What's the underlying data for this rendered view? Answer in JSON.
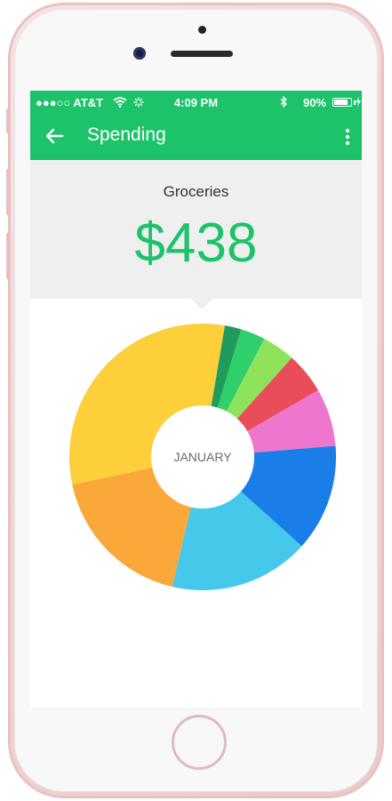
{
  "status_bar": {
    "carrier": "●●●○○ AT&T",
    "time": "4:09 PM",
    "battery_text": "90%",
    "battery_level": 0.9
  },
  "app_bar": {
    "title": "Spending"
  },
  "summary": {
    "category": "Groceries",
    "amount": "$438"
  },
  "chart_data": {
    "type": "pie",
    "center_label": "JANUARY",
    "slices": [
      {
        "value": 31,
        "color": "#fccf3b"
      },
      {
        "value": 2,
        "color": "#1f9b5c"
      },
      {
        "value": 3,
        "color": "#2fcf6b"
      },
      {
        "value": 4,
        "color": "#8fe35a"
      },
      {
        "value": 5,
        "color": "#ea4d5a"
      },
      {
        "value": 7,
        "color": "#ef76cf"
      },
      {
        "value": 13,
        "color": "#1a7ee8"
      },
      {
        "value": 17,
        "color": "#46c8ea"
      },
      {
        "value": 18,
        "color": "#fba83a"
      }
    ]
  },
  "colors": {
    "accent": "#1dc36a",
    "summary_bg": "#efeff0"
  }
}
